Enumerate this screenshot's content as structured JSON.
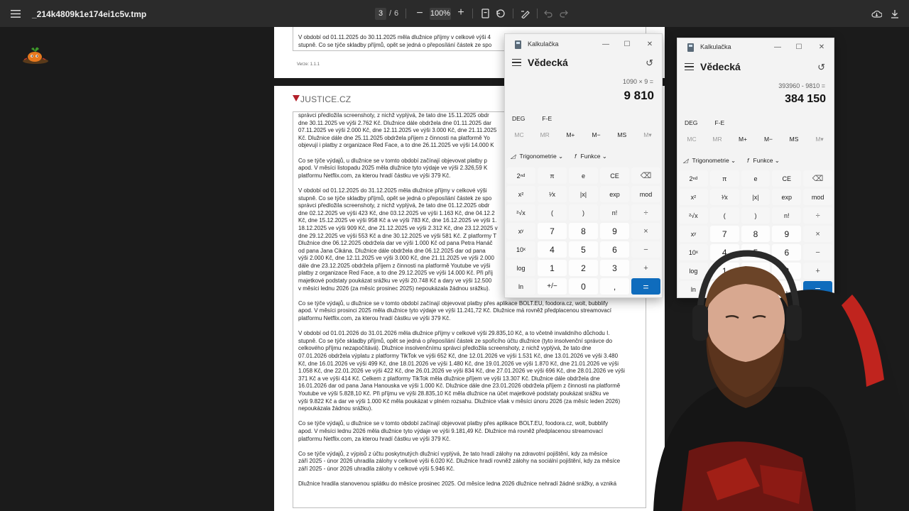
{
  "viewer": {
    "filename": "_214k4809k1e174ei1c5v.tmp",
    "page_current": "3",
    "page_sep": "/",
    "page_total": "6",
    "zoom": "100%",
    "zoom_out": "−",
    "zoom_in": "+"
  },
  "page_top": {
    "lines": [
      "V období od 01.11.2025 do 30.11.2025 měla dlužnice příjmy v celkové výši 4",
      "stupně. Co se týče skladby příjmů, opět se jedná o přeposílání částek ze spo"
    ],
    "footer": "Verze: 1.1.1"
  },
  "page_main": {
    "logo_text": "JUSTICE.CZ",
    "paragraphs": [
      "správci předložila screenshoty, z nichž vyplývá, že tato dne 15.11.2025 obdr\ndne 30.11.2025 ve výši 2.762 Kč. Dlužnice dále obdržela dne 01.11.2025 dar\n07.11.2025 ve výši 2.000 Kč, dne 12.11.2025 ve výši 3.000 Kč, dne 21.11.2025\nKč. Dlužnice dále dne 25.11.2025 obdržela příjem z činnosti na platformě Yo\nobjevují i platby z organizace Red Face, a to dne 26.11.2025 ve výši 14.000 K",
      "Co se týče výdajů, u dlužnice se v tomto období začínají objevovat platby p\napod. V měsíci listopadu 2025 měla dlužnice tyto výdaje ve výši 2.326,59 K\nplatformu Netflix.com, za kterou hradí částku ve výši 379 Kč.",
      "V období od 01.12.2025 do 31.12.2025 měla dlužnice příjmy v celkové výši\nstupně. Co se týče skladby příjmů, opět se jedná o přeposílání částek ze spo\nsprávci předložila screenshoty, z nichž vyplývá, že tato dne 01.12.2025 obdr\ndne 02.12.2025 ve výši 423 Kč, dne 03.12.2025 ve výši 1.163 Kč, dne 04.12.2\nKč, dne 15.12.2025 ve výši 958 Kč a ve výši 783 Kč, dne 16.12.2025 ve výši 1.\n18.12.2025 ve výši 909 Kč, dne 21.12.2025 ve výši 2.312 Kč, dne 23.12.2025 v\ndne 29.12.2025 ve výši 553 Kč a dne 30.12.2025 ve výši 581 Kč. Z platformy T\nDlužnice dne 06.12.2025 obdržela dar ve výši 1.000 Kč od pana Petra Hanáč\nod pana Jana Cikána. Dlužnice dále obdržela dne 06.12.2025 dar od pana\nvýši 2.000 Kč, dne 12.11.2025 ve výši 3.000 Kč, dne 21.11.2025 ve výši 2.000\ndále dne 23.12.2025 obdržela příjem z činnosti na platformě Youtube ve výši\nplatby z organizace Red Face, a to dne 29.12.2025 ve výši 14.000 Kč. Při příj\nmajetkové podstaty poukázat srážku ve výši 20.748 Kč a dary ve výši 12.500\nv měsíci lednu 2026 (za měsíc prosinec 2025) nepoukázala žádnou srážku).",
      "Co se týče výdajů, u dlužnice se v tomto období začínají objevovat platby přes aplikace BOLT.EU, foodora.cz, wolt, bubblify\napod. V měsíci prosinci 2025 měla dlužnice tyto výdaje ve výši 11.241,72 Kč. Dlužnice má rovněž předplacenou streamovací\nplatformu Netflix.com, za kterou hradí částku ve výši 379 Kč.",
      "V období od 01.01.2026 do 31.01.2026 měla dlužnice příjmy v celkové výši 29.835,10 Kč, a to včetně invalidního důchodu I.\nstupně. Co se týče skladby příjmů, opět se jedná o přeposílání částek ze spořicího účtu dlužnice (tyto insolvenční správce do\ncelkového příjmu nezapočítává). Dlužnice insolvenčnímu správci předložila screenshoty, z nichž vyplývá, že tato dne\n07.01.2026 obdržela výplatu z platformy TikTok ve výši 652 Kč, dne 12.01.2026 ve výši 1.531 Kč, dne 13.01.2026 ve výši 3.480\nKč, dne 16.01.2026 ve výši 499 Kč, dne 18.01.2026 ve výši 1.480 Kč, dne 19.01.2026 ve výši 1.870 Kč, dne 21.01.2026 ve výši\n1.058 Kč, dne 22.01.2026 ve výši 422 Kč, dne 26.01.2026 ve výši 834 Kč, dne 27.01.2026 ve výši 696 Kč, dne 28.01.2026 ve výši\n371 Kč a ve výši 414 Kč. Celkem z platformy TikTok měla dlužnice příjem ve výši 13.307 Kč. Dlužnice dále obdržela dne\n16.01.2026 dar od pana Jana Hanouska ve výši 1.000 Kč. Dlužnice dále dne 23.01.2026 obdržela příjem z činnosti na platformě\nYoutube ve výši 5.828,10 Kč. Při příjmu ve výši 28.835,10 Kč měla dlužnice na účet majetkové podstaty poukázat srážku ve\nvýši 9.822 Kč a dar ve výši 1.000 Kč měla poukázat v plném rozsahu. Dlužnice však v měsíci únoru 2026 (za měsíc leden 2026)\nnepoukázala žádnou srážku).",
      "Co se týče výdajů, u dlužnice se v tomto období začínají objevovat platby přes aplikace BOLT.EU, foodora.cz, wolt, bubblify\napod. V měsíci lednu 2026 měla dlužnice tyto výdaje ve výši 9.181,49 Kč. Dlužnice má rovněž předplacenou streamovací\nplatformu Netflix.com, za kterou hradí částku ve výši 379 Kč.",
      "Co se týče výdajů, z výpisů z účtu poskytnutých dlužnicí vyplývá, že tato hradí zálohy na zdravotní pojištění, kdy za měsíce\nzáří 2025 - únor 2026 uhradila zálohy v celkové výši 6.020 Kč. Dlužnice hradí rovněž zálohy na sociální pojištění, kdy za měsíce\nzáří 2025 - únor 2026 uhradila zálohy v celkové výši 5.946 Kč.",
      "Dlužnice hradila stanovenou splátku do měsíce prosinec 2025. Od měsíce ledna 2026 dlužnice nehradí žádné srážky, a vzniká"
    ]
  },
  "calc_front": {
    "app_title": "Kalkulačka",
    "mode": "Vědecká",
    "expression": "1090 × 9 =",
    "result": "9 810"
  },
  "calc_back": {
    "app_title": "Kalkulačka",
    "mode": "Vědecká",
    "expression": "393960 - 9810 =",
    "result": "384 150"
  },
  "calc_common": {
    "angle": "DEG",
    "fe": "F-E",
    "memory": [
      "MC",
      "MR",
      "M+",
      "M−",
      "MS",
      "M▾"
    ],
    "trig_label": "Trigonometrie",
    "func_label": "Funkce",
    "keys": [
      "2ⁿᵈ",
      "π",
      "e",
      "CE",
      "⌫",
      "x²",
      "¹⁄x",
      "|x|",
      "exp",
      "mod",
      "²√x",
      "(",
      ")",
      "n!",
      "÷",
      "xʸ",
      "7",
      "8",
      "9",
      "×",
      "10ˣ",
      "4",
      "5",
      "6",
      "−",
      "log",
      "1",
      "2",
      "3",
      "+",
      "ln",
      "+/−",
      "0",
      ",",
      "="
    ]
  },
  "colors": {
    "toolbar": "#2b2b2b",
    "equals": "#0f6cbd",
    "justice_red": "#b3202a"
  }
}
